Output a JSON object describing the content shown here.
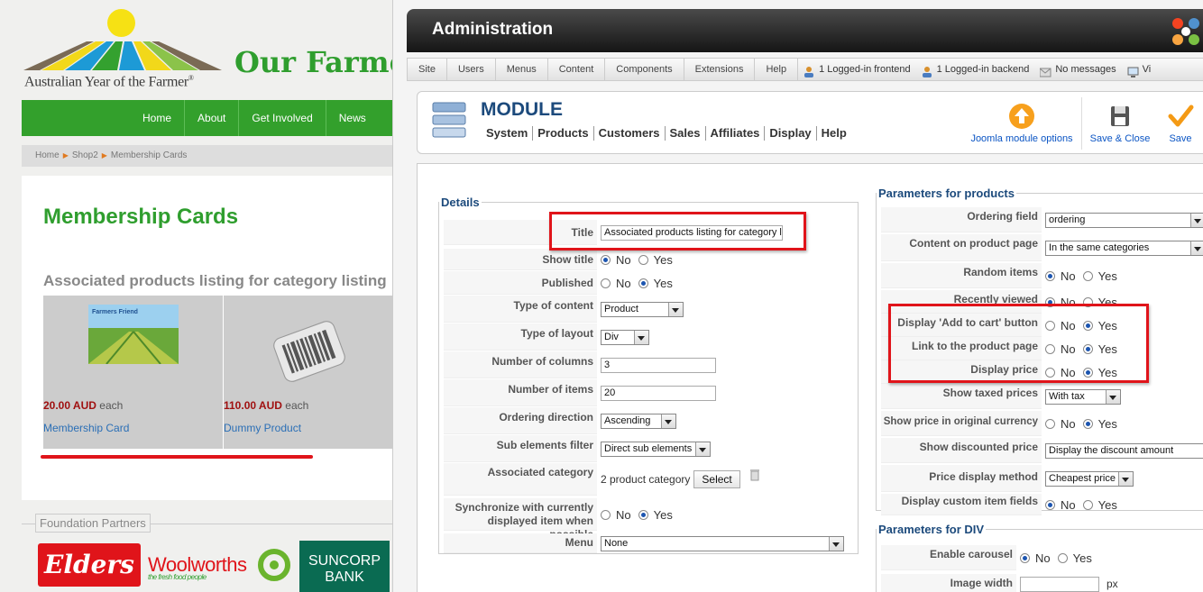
{
  "site": {
    "logo_text": "Australian Year of the Farmer",
    "logo_reg": "®",
    "name": "Our Farmers",
    "nav": [
      "Home",
      "About",
      "Get Involved",
      "News"
    ],
    "breadcrumb": [
      "Home",
      "Shop2",
      "Membership Cards"
    ],
    "page_title": "Membership Cards",
    "sub_title": "Associated products listing for category listing",
    "products": [
      {
        "price": "20.00 AUD",
        "each": "each",
        "name": "Membership Card",
        "image_text": "Farmers Friend"
      },
      {
        "price": "110.00 AUD",
        "each": "each",
        "name": "Dummy Product"
      }
    ],
    "partners_label": "Foundation Partners",
    "partners": {
      "elders": "Elders",
      "woolworths": "Woolworths",
      "woolworths_tag": "the fresh food people",
      "suncorp": [
        "SUNCORP",
        "BANK"
      ]
    }
  },
  "admin": {
    "title": "Administration",
    "menu": [
      "Site",
      "Users",
      "Menus",
      "Content",
      "Components",
      "Extensions",
      "Help"
    ],
    "status": [
      "1 Logged-in frontend",
      "1 Logged-in backend",
      "No messages",
      "Vi"
    ],
    "module_title": "MODULE",
    "subnav": [
      "System",
      "Products",
      "Customers",
      "Sales",
      "Affiliates",
      "Display",
      "Help"
    ],
    "toolbar": {
      "options": "Joomla module options",
      "save_close": "Save & Close",
      "save": "Save"
    },
    "details": {
      "legend": "Details",
      "title_label": "Title",
      "title_value": "Associated products listing for category listing",
      "show_title": "Show title",
      "published": "Published",
      "type_content": "Type of content",
      "type_content_val": "Product",
      "type_layout": "Type of layout",
      "type_layout_val": "Div",
      "num_cols": "Number of columns",
      "num_cols_val": "3",
      "num_items": "Number of items",
      "num_items_val": "20",
      "order_dir": "Ordering direction",
      "order_dir_val": "Ascending",
      "sub_filter": "Sub elements filter",
      "sub_filter_val": "Direct sub elements",
      "assoc_cat": "Associated category",
      "assoc_cat_val": "2 product category",
      "select_btn": "Select",
      "sync_1": "Synchronize with currently",
      "sync_2": "displayed item when possible",
      "menu": "Menu",
      "menu_val": "None",
      "no": "No",
      "yes": "Yes"
    },
    "params": {
      "legend": "Parameters for products",
      "ordering_field": "Ordering field",
      "ordering_field_val": "ordering",
      "content_page": "Content on product page",
      "content_page_val": "In the same categories",
      "random": "Random items",
      "recent": "Recently viewed",
      "add_cart": "Display 'Add to cart' button",
      "link_page": "Link to the product page",
      "display_price": "Display price",
      "show_taxed": "Show taxed prices",
      "show_taxed_val": "With tax",
      "orig_currency": "Show price in original currency",
      "discounted": "Show discounted price",
      "discounted_val": "Display the discount amount",
      "price_method": "Price display method",
      "price_method_val": "Cheapest price",
      "custom_fields": "Display custom item fields"
    },
    "paramsdiv": {
      "legend": "Parameters for DIV",
      "carousel": "Enable carousel",
      "img_width": "Image width",
      "px": "px"
    }
  }
}
